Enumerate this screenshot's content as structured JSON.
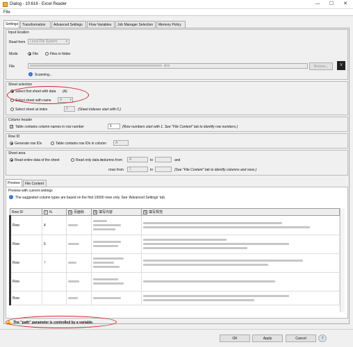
{
  "window": {
    "title": "Dialog - 10:616 - Excel Reader",
    "minimize": "—",
    "maximize": "☐",
    "close": "✕"
  },
  "menu": {
    "file": "File"
  },
  "tabs": [
    "Settings",
    "Transformation",
    "Advanced Settings",
    "Flow Variables",
    "Job Manager Selection",
    "Memory Policy"
  ],
  "input_location": {
    "title": "Input location",
    "read_from_label": "Read from",
    "read_from_value": "Local File System",
    "mode_label": "Mode",
    "mode_file": "File",
    "mode_folder": "Files in folder",
    "file_label": "File",
    "file_path_suffix": ".xlsx",
    "browse_label": "Browse...",
    "scanning": "Scanning..."
  },
  "sheet_selection": {
    "title": "Sheet selection",
    "first_sheet": "Select first sheet with data",
    "first_sheet_hint": "(A)",
    "by_name": "Select sheet with name",
    "by_name_value": "A",
    "by_index": "Select sheet at index",
    "index_value": "0",
    "index_hint": "(Sheet indexes start with 0.)"
  },
  "column_header": {
    "title": "Column header",
    "checkbox_label": "Table contains column names in row number",
    "row_number": "1",
    "hint": "(Row numbers start with 1. See \"File Content\" tab to identify row numbers.)"
  },
  "row_id": {
    "title": "Row ID",
    "generate": "Generate row IDs",
    "in_column": "Table contains row IDs in column",
    "column_value": "A"
  },
  "sheet_area": {
    "title": "Sheet area",
    "entire": "Read entire data of the sheet",
    "only": "Read only data in",
    "columns_from": "columns from",
    "col_from_value": "A",
    "and": "and",
    "rows_from": "rows from",
    "row_from_value": "1",
    "to": "to",
    "hint": "(See \"File Content\" tab to identify columns and rows.)"
  },
  "preview": {
    "tabs": [
      "Preview",
      "File Content"
    ],
    "group_title": "Preview with current settings",
    "info": "The suggested column types are based on the first 10000 rows only. See 'Advanced Settings' tab.",
    "columns": [
      {
        "type": "",
        "name": "Row ID"
      },
      {
        "type": "I",
        "name": "N."
      },
      {
        "type": "S",
        "name": "页面标"
      },
      {
        "type": "S",
        "name": "填写内容"
      },
      {
        "type": "S",
        "name": "填写规范"
      }
    ],
    "rows": [
      {
        "id": "Row",
        "n": "4"
      },
      {
        "id": "Row",
        "n": "6"
      },
      {
        "id": "Row",
        "n": "7"
      },
      {
        "id": "Row",
        "n": ""
      },
      {
        "id": "Row",
        "n": ""
      }
    ]
  },
  "status": {
    "message": "The \"path\" parameter is controlled by a variable."
  },
  "buttons": {
    "ok": "OK",
    "apply": "Apply",
    "cancel": "Cancel",
    "help": "?"
  },
  "colors": {
    "highlight_oval": "#d02020",
    "warning": "#f0b400"
  }
}
